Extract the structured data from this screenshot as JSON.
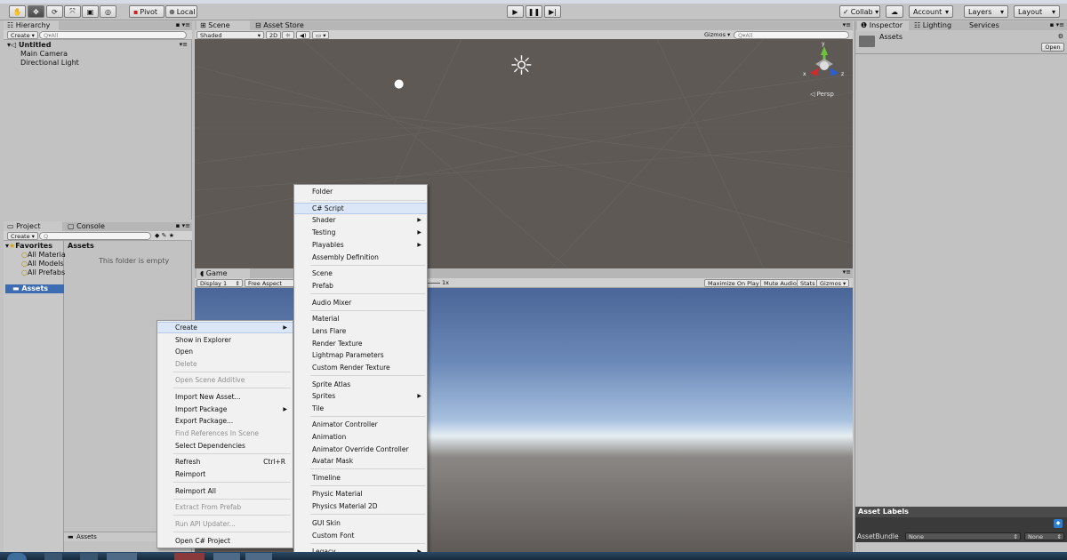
{
  "toolbar": {
    "tool_icons": [
      "hand-icon",
      "move-icon",
      "rotate-icon",
      "scale-icon",
      "rect-icon",
      "transform-icon"
    ],
    "pivot": "Pivot",
    "local": "Local",
    "collab": "Collab ▾",
    "account": "Account",
    "layers": "Layers",
    "layout": "Layout"
  },
  "hierarchy": {
    "tab": "Hierarchy",
    "create": "Create ▾",
    "search_placeholder": "Q▾All",
    "scene_name": "Untitled",
    "items": [
      "Main Camera",
      "Directional Light"
    ]
  },
  "scene": {
    "tab": "Scene",
    "store_tab": "Asset Store",
    "shading": "Shaded",
    "mode2d": "2D",
    "gizmos": "Gizmos ▾",
    "search_placeholder": "Q▾All",
    "persp": "◁ Persp",
    "axis_y": "y",
    "axis_x": "x",
    "axis_z": "z"
  },
  "game": {
    "tab": "Game",
    "display": "Display 1",
    "aspect": "Free Aspect",
    "scale": "1x",
    "maximize": "Maximize On Play",
    "mute": "Mute Audio",
    "stats": "Stats",
    "gizmos": "Gizmos ▾"
  },
  "project": {
    "tab": "Project",
    "console_tab": "Console",
    "create": "Create ▾",
    "favorites": "Favorites",
    "favorite_items": [
      "All Materia",
      "All Models",
      "All Prefabs"
    ],
    "assets_folder": "Assets",
    "assets_header": "Assets",
    "empty_text": "This folder is empty",
    "footer_path": "Assets"
  },
  "inspector": {
    "tab": "Inspector",
    "lighting_tab": "Lighting",
    "services_tab": "Services",
    "title": "Assets",
    "open_button": "Open",
    "asset_labels": "Asset Labels",
    "asset_bundle_label": "AssetBundle",
    "bundle_value": "None",
    "variant_value": "None"
  },
  "context_menu": {
    "items": [
      {
        "label": "Create",
        "arrow": true,
        "highlight": true
      },
      {
        "label": "Show in Explorer"
      },
      {
        "label": "Open"
      },
      {
        "label": "Delete",
        "disabled": true
      },
      {
        "label": "Open Scene Additive",
        "disabled": true
      },
      {
        "label": "Import New Asset..."
      },
      {
        "label": "Import Package",
        "arrow": true
      },
      {
        "label": "Export Package..."
      },
      {
        "label": "Find References In Scene",
        "disabled": true
      },
      {
        "label": "Select Dependencies"
      },
      {
        "label": "Refresh",
        "shortcut": "Ctrl+R"
      },
      {
        "label": "Reimport"
      },
      {
        "label": "Reimport All"
      },
      {
        "label": "Extract From Prefab",
        "disabled": true
      },
      {
        "label": "Run API Updater...",
        "disabled": true
      },
      {
        "label": "Open C# Project"
      }
    ]
  },
  "create_menu": {
    "items": [
      {
        "label": "Folder"
      },
      {
        "label": "C# Script",
        "highlight": true
      },
      {
        "label": "Shader",
        "arrow": true
      },
      {
        "label": "Testing",
        "arrow": true
      },
      {
        "label": "Playables",
        "arrow": true
      },
      {
        "label": "Assembly Definition"
      },
      {
        "label": "Scene"
      },
      {
        "label": "Prefab"
      },
      {
        "label": "Audio Mixer"
      },
      {
        "label": "Material"
      },
      {
        "label": "Lens Flare"
      },
      {
        "label": "Render Texture"
      },
      {
        "label": "Lightmap Parameters"
      },
      {
        "label": "Custom Render Texture"
      },
      {
        "label": "Sprite Atlas"
      },
      {
        "label": "Sprites",
        "arrow": true
      },
      {
        "label": "Tile"
      },
      {
        "label": "Animator Controller"
      },
      {
        "label": "Animation"
      },
      {
        "label": "Animator Override Controller"
      },
      {
        "label": "Avatar Mask"
      },
      {
        "label": "Timeline"
      },
      {
        "label": "Physic Material"
      },
      {
        "label": "Physics Material 2D"
      },
      {
        "label": "GUI Skin"
      },
      {
        "label": "Custom Font"
      },
      {
        "label": "Legacy",
        "arrow": true
      }
    ]
  },
  "colors": {
    "panel_bg": "#c2c2c2",
    "scene_bg": "#5e5955",
    "menu_highlight": "#dbe7f7",
    "axis_x": "#d02a2a",
    "axis_y": "#6cc43a",
    "axis_z": "#2a5fd0"
  }
}
